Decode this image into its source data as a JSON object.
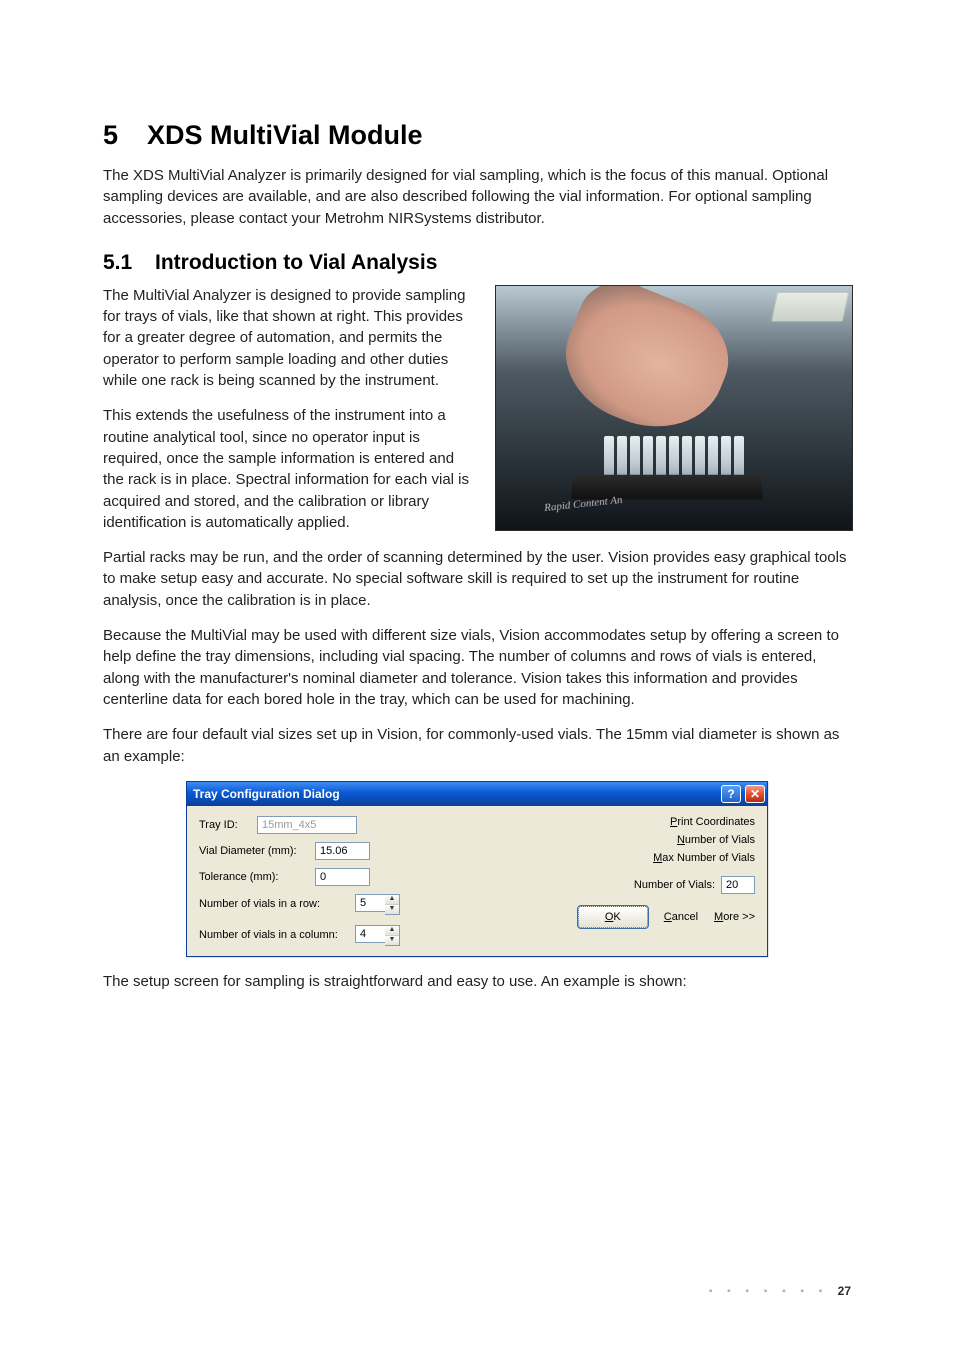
{
  "chapter": {
    "number": "5",
    "title": "XDS MultiVial Module"
  },
  "intro_paragraph": "The XDS MultiVial Analyzer is primarily designed for vial sampling, which is the focus of this manual. Optional sampling devices are available, and are also described following the vial information. For optional sampling accessories, please contact your Metrohm NIRSystems distributor.",
  "section": {
    "number": "5.1",
    "title": "Introduction to Vial Analysis"
  },
  "paragraphs": {
    "p1": "The MultiVial Analyzer is designed to provide sampling for trays of vials, like that shown at right. This provides for a greater degree of automation, and permits the operator to perform sample loading and other duties while one rack is being scanned by the instrument.",
    "p2": "This extends the usefulness of the instrument into a routine analytical tool, since no operator input is required, once the sample information is entered and the rack is in place. Spectral information for each vial is acquired and stored, and the calibration or library identification is automatically applied.",
    "p3": "Partial racks may be run, and the order of scanning determined by the user. Vision provides easy graphical tools to make setup easy and accurate. No special software skill is required to set up the instrument for routine analysis, once the calibration is in place.",
    "p4": "Because the MultiVial may be used with different size vials, Vision accommodates setup by offering a screen to help define the tray dimensions, including vial spacing. The number of columns and rows of vials is entered, along with the manufacturer's nominal diameter and tolerance. Vision takes this information and provides centerline data for each bored hole in the tray, which can be used for machining.",
    "p5": "There are four default vial sizes set up in Vision, for commonly-used vials. The 15mm vial diameter is shown as an example:",
    "p6": "The setup screen for sampling is straightforward and easy to use. An example is shown:"
  },
  "photo": {
    "device_label": "Rapid Content An"
  },
  "dialog": {
    "title": "Tray Configuration Dialog",
    "help_symbol": "?",
    "close_symbol": "✕",
    "labels": {
      "tray_id": "Tray ID:",
      "vial_diameter": "Vial Diameter (mm):",
      "tolerance": "Tolerance (mm):",
      "vials_row": "Number of vials in a row:",
      "vials_column": "Number of vials in a column:",
      "number_of_vials_static": "Number of Vials:"
    },
    "values": {
      "tray_id": "15mm_4x5",
      "vial_diameter": "15.06",
      "tolerance": "0",
      "vials_row": "5",
      "vials_column": "4",
      "number_of_vials": "20"
    },
    "links": {
      "print_coordinates": "Print Coordinates",
      "print_coordinates_ul": "P",
      "number_of_vials": "Number of Vials",
      "number_of_vials_ul": "N",
      "max_number_of_vials": "Max Number of Vials",
      "max_number_of_vials_ul": "M"
    },
    "buttons": {
      "ok": "OK",
      "ok_ul": "O",
      "cancel": "Cancel",
      "cancel_ul": "C",
      "more": "More >>",
      "more_ul": "M"
    },
    "spin_up": "▲",
    "spin_down": "▼"
  },
  "page_number": "27",
  "footer_dots": "▪ ▪ ▪ ▪ ▪ ▪ ▪"
}
